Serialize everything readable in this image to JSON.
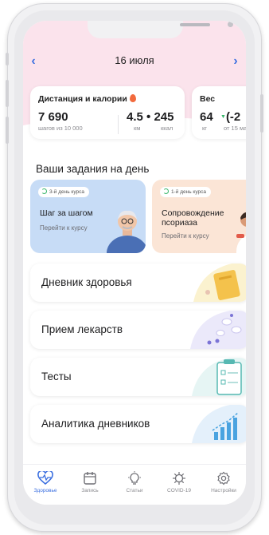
{
  "header": {
    "date": "16 июля",
    "prev_icon": "chevron-left-icon",
    "next_icon": "chevron-right-icon",
    "accent": "#3b6fe0"
  },
  "stats": [
    {
      "title": "Дистанция и калории",
      "steps_value": "7 690",
      "steps_caption": "шагов из 10 000",
      "km_value": "4.5",
      "kcal_value": "245",
      "km_unit": "км",
      "kcal_unit": "ккал"
    },
    {
      "title": "Вес",
      "value": "64",
      "unit": "кг",
      "delta": "(-2",
      "delta_caption": "от 15 ма"
    }
  ],
  "tasks": {
    "title": "Ваши задания на день",
    "courses": [
      {
        "day": "3-й день курса",
        "title": "Шаг за шагом",
        "link": "Перейти к курсу"
      },
      {
        "day": "1-й день курса",
        "title_line1": "Сопровождение",
        "title_line2": "псориаза",
        "link": "Перейти к курсу"
      }
    ]
  },
  "menu": [
    {
      "label": "Дневник здоровья"
    },
    {
      "label": "Прием лекарств"
    },
    {
      "label": "Тесты"
    },
    {
      "label": "Аналитика дневников"
    }
  ],
  "nav": [
    {
      "label": "Здоровье",
      "icon": "heart-pulse-icon",
      "active": true
    },
    {
      "label": "Запись",
      "icon": "calendar-icon",
      "active": false
    },
    {
      "label": "Статьи",
      "icon": "lightbulb-icon",
      "active": false
    },
    {
      "label": "COVID-19",
      "icon": "virus-icon",
      "active": false
    },
    {
      "label": "Настройки",
      "icon": "gear-icon",
      "active": false
    }
  ]
}
